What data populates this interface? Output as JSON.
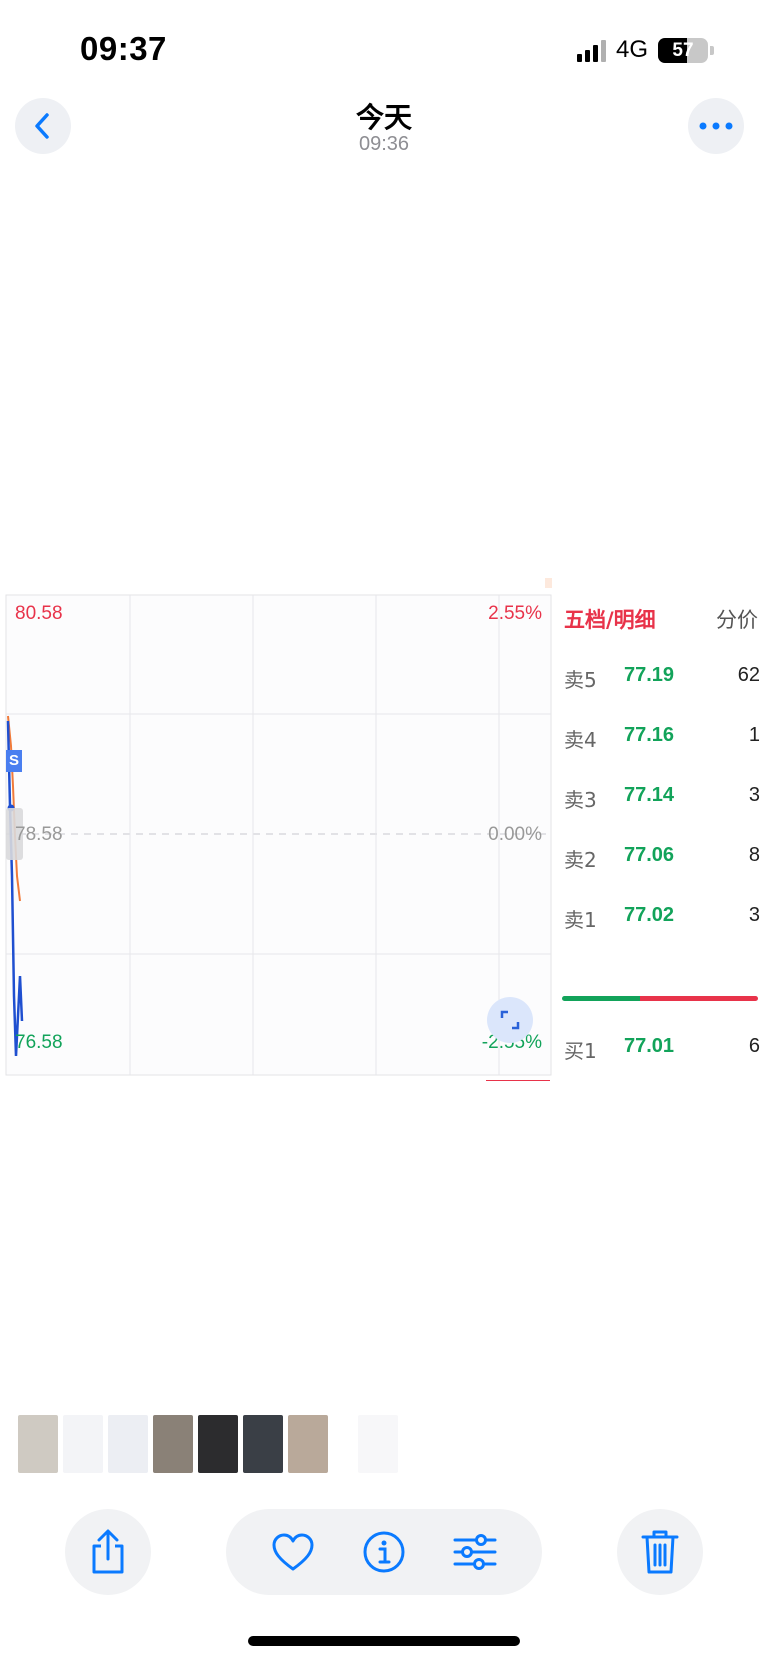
{
  "status_bar": {
    "time": "09:37",
    "network": "4G",
    "battery": "57",
    "battery_level": 0.57
  },
  "header": {
    "title": "今天",
    "subtitle": "09:36"
  },
  "shared_image": {
    "chart": {
      "top_price": "80.58",
      "top_pct": "2.55%",
      "mid_price": "78.58",
      "mid_pct": "0.00%",
      "bottom_price": "76.58",
      "bottom_pct": "-2.55%",
      "marker": "S",
      "colors": {
        "up": "#e8334a",
        "down": "#12a35a",
        "price_line": "#1f4fd0",
        "avg_line": "#f07a3a"
      }
    },
    "order_book": {
      "title": "五档/明细",
      "tab": "分价",
      "rows": [
        {
          "name": "卖5",
          "price": "77.19",
          "volume": "62"
        },
        {
          "name": "卖4",
          "price": "77.16",
          "volume": "1"
        },
        {
          "name": "卖3",
          "price": "77.14",
          "volume": "3"
        },
        {
          "name": "卖2",
          "price": "77.06",
          "volume": "8"
        },
        {
          "name": "卖1",
          "price": "77.02",
          "volume": "3"
        },
        {
          "name": "买1",
          "price": "77.01",
          "volume": "6"
        }
      ],
      "sell_ratio": 0.4
    }
  },
  "thumbnails": [
    {
      "name": "thumb-photo-1",
      "color": "#cfcac2"
    },
    {
      "name": "thumb-chart-1",
      "color": "#f3f4f7"
    },
    {
      "name": "thumb-chart-2",
      "color": "#eceef3"
    },
    {
      "name": "thumb-photo-2",
      "color": "#8a8177"
    },
    {
      "name": "thumb-photo-3",
      "color": "#2c2c2e"
    },
    {
      "name": "thumb-photo-4",
      "color": "#3a3f46"
    },
    {
      "name": "thumb-photo-5",
      "color": "#b9a99a"
    },
    {
      "name": "thumb-chart-current",
      "color": "#f7f7f9"
    }
  ],
  "toolbar": {
    "share": "share-icon",
    "favorite": "heart-icon",
    "info": "info-icon",
    "adjust": "sliders-icon",
    "delete": "trash-icon",
    "accent": "#0a7aff"
  }
}
